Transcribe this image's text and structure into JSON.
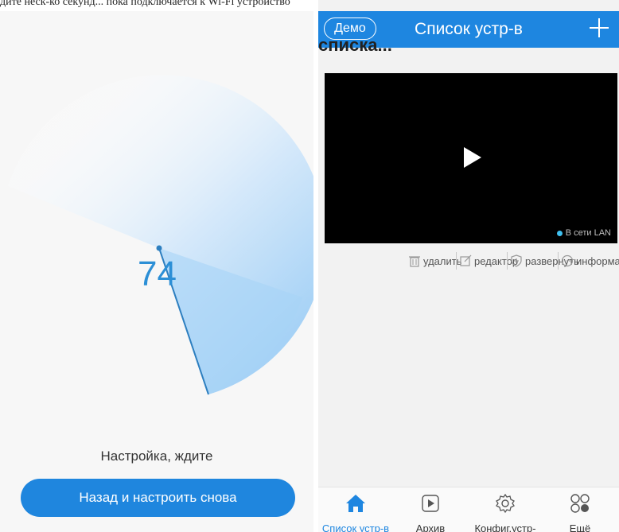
{
  "caption": "дите неск-ко секунд... пока подключается к Wi-Fi устройство",
  "setup": {
    "progress": "74",
    "status_text": "Настройка, ждите",
    "back_button_label": "Назад и настроить снова"
  },
  "device_list": {
    "header": {
      "demo_label": "Демо",
      "title": "Список устр-в"
    },
    "cut_text": "списка...",
    "device": {
      "status": "В сети LAN"
    },
    "actions": [
      {
        "label": "удалить",
        "icon": "trash-icon"
      },
      {
        "label": "редактор",
        "icon": "edit-icon"
      },
      {
        "label": "развернуть",
        "icon": "shield-plus-icon"
      },
      {
        "label": "информа...",
        "icon": "chat-icon"
      }
    ],
    "nav": [
      {
        "label": "Список устр-в",
        "icon": "home-icon",
        "active": true
      },
      {
        "label": "Архив",
        "icon": "play-square-icon",
        "active": false
      },
      {
        "label": "Конфиг.устр-",
        "icon": "gear-icon",
        "active": false
      },
      {
        "label": "Ещё",
        "icon": "circles-icon",
        "active": false
      }
    ]
  },
  "colors": {
    "accent": "#1e86e0",
    "radar": "#8cc6f3",
    "lan_dot": "#3fc0f0"
  }
}
